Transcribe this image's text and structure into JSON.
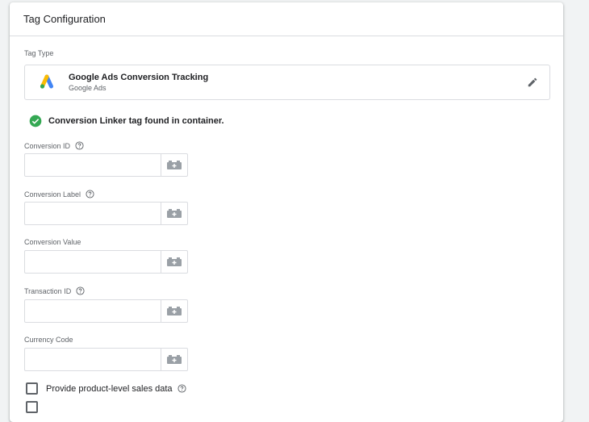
{
  "header": {
    "title": "Tag Configuration"
  },
  "tag_type": {
    "label": "Tag Type",
    "name": "Google Ads Conversion Tracking",
    "subtitle": "Google Ads",
    "logo_icon": "google-ads-logo",
    "edit_icon": "pencil-icon"
  },
  "notice": {
    "text": "Conversion Linker tag found in container.",
    "icon": "check-circle-icon",
    "color": "#34a853"
  },
  "fields": [
    {
      "label": "Conversion ID",
      "value": "",
      "has_help": true
    },
    {
      "label": "Conversion Label",
      "value": "",
      "has_help": true
    },
    {
      "label": "Conversion Value",
      "value": "",
      "has_help": false
    },
    {
      "label": "Transaction ID",
      "value": "",
      "has_help": true
    },
    {
      "label": "Currency Code",
      "value": "",
      "has_help": false
    }
  ],
  "checkboxes": [
    {
      "label": "Provide product-level sales data",
      "checked": false,
      "has_help": true
    }
  ],
  "colors": {
    "google_blue": "#4285f4",
    "google_yellow": "#fbbc04",
    "google_green": "#34a853",
    "border": "#dadce0"
  }
}
